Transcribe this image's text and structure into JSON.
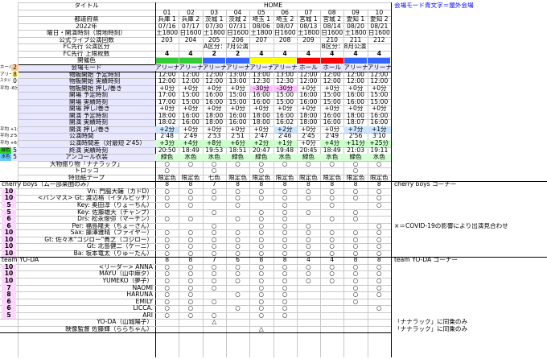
{
  "sheet": {
    "note_right": "会場モード青文字＝屋外会場",
    "colors": {
      "heading_lavender": "#ccccff",
      "lavender_light": "#e7e7ff",
      "navy_cell": "#c9cdea",
      "green_cell": "#33cc33",
      "blue_cell": "#3366ff",
      "yellow_cell": "#ffff00",
      "red_cell": "#ff0000",
      "minus_pink": "#ffc0ff",
      "plus_blue": "#cce5ff",
      "plus_green": "#ccffcc",
      "costume_green": "#d6ffd6",
      "member_pink": "#ffd6ff",
      "blue_text": "#0000ff",
      "purple_text": "#800080"
    },
    "title": "タイトル",
    "home": "HOME",
    "show_numbers": [
      "01",
      "02",
      "03",
      "04",
      "05",
      "06",
      "07",
      "08",
      "09",
      "10"
    ],
    "row_labels": {
      "pref": "都道府県",
      "year": "2022年",
      "date_venue": "曜日・開演時刻（現地時刻）",
      "official_count": "公式ライブ公演回数",
      "fc_kind": "FC先行 公演区分",
      "fc_limit": "FC先行 上限枚数",
      "region_color": "開催色",
      "venue_mode": "会場モード",
      "merch_plan": "物販開始  予定時刻",
      "merch_actual": "物販開始  実績時刻",
      "merch_diff": "物販開始  押し/巻き",
      "open_plan": "開場    予定時刻",
      "open_actual": "開場    実績時刻",
      "open_diff": "開場    押し/巻き",
      "start_plan": "開演    予定時刻",
      "start_actual": "開演    実績時刻",
      "start_diff": "開演    押し/巻き",
      "duration": "公演時間",
      "duration_diff": "公演時間差（対最短 2'45）",
      "end": "終演    実績時刻",
      "encore": "アンコール衣装",
      "flag": "大物振り物「ナナラック」",
      "trolley": "トロッコ",
      "tape": "特効紙テープ"
    },
    "left_margin": {
      "hall": "ホール",
      "hall_n": "2",
      "arena": "アリーナ",
      "arena_n": "8",
      "stadium": "スタジアム",
      "stadium_n": "0",
      "avg1": "平均 -6分",
      "avg2": "平均 +1分",
      "avg3": "平均 2'51",
      "avg4": "平均 +6分",
      "green": "緑色",
      "green_n": "5",
      "blue": "水色",
      "blue_n": "5"
    },
    "prefs": [
      "兵庫 1",
      "兵庫 2",
      "茨城 1",
      "茨城 2",
      "埼玉 1",
      "埼玉 2",
      "宮城 1",
      "宮城 2",
      "愛知 1",
      "愛知 2"
    ],
    "dates": [
      "07/16",
      "07/17",
      "07/30",
      "07/31",
      "08/06",
      "08/07",
      "08/13",
      "08/14",
      "08/20",
      "08/21"
    ],
    "times": [
      "土1800",
      "日1600",
      "土1800",
      "日1600",
      "土1800",
      "日1600",
      "土1800",
      "日1600",
      "土1800",
      "日1600"
    ],
    "counts": [
      "203",
      "204",
      "205",
      "206",
      "207",
      "208",
      "209",
      "210",
      "211",
      "212"
    ],
    "fc_a": "A区分：7月公演",
    "fc_b": "B区分：8月公演",
    "fc_limits": [
      "4",
      "4",
      "2",
      "2",
      "4",
      "4",
      "4",
      "4",
      "4",
      "4"
    ],
    "venue_modes": [
      "アリーナ",
      "アリーナ",
      "アリーナ",
      "アリーナ",
      "アリーナ",
      "アリーナ",
      "ホール",
      "ホール",
      "アリーナ",
      "アリーナ"
    ],
    "merch_plan": [
      "12:00",
      "12:00",
      "12:00",
      "13:00",
      "13:00",
      "13:00",
      "12:00",
      "12:00",
      "12:00",
      "12:00"
    ],
    "merch_actual": [
      "12:00",
      "12:00",
      "12:00",
      "13:00",
      "12:30",
      "12:30",
      "12:00",
      "12:00",
      "12:00",
      "12:00"
    ],
    "merch_diff": [
      "+0分",
      "+0分",
      "+0分",
      "+0分",
      "-30分",
      "-30分",
      "+0分",
      "+0分",
      "+0分",
      "+0分"
    ],
    "open_plan": [
      "17:00",
      "15:00",
      "16:00",
      "15:00",
      "16:00",
      "15:00",
      "16:00",
      "15:00",
      "16:00",
      "15:00"
    ],
    "open_actual": [
      "17:00",
      "15:00",
      "16:00",
      "15:00",
      "16:00",
      "15:00",
      "16:00",
      "15:00",
      "16:00",
      "15:00"
    ],
    "open_diff": [
      "+0分",
      "+0分",
      "+0分",
      "+0分",
      "+0分",
      "+0分",
      "+0分",
      "+0分",
      "+0分",
      "+0分"
    ],
    "start_plan": [
      "18:00",
      "16:00",
      "18:00",
      "16:00",
      "18:00",
      "16:00",
      "18:00",
      "16:00",
      "18:00",
      "16:00"
    ],
    "start_actual": [
      "18:02",
      "16:00",
      "18:00",
      "16:00",
      "18:00",
      "16:02",
      "18:00",
      "16:00",
      "18:07",
      "16:00"
    ],
    "start_diff": [
      "+2分",
      "+0分",
      "+0分",
      "+0分",
      "+0分",
      "+2分",
      "+0分",
      "+0分",
      "+7分",
      "+1分"
    ],
    "durations": [
      "2'48",
      "2'49",
      "2'53",
      "2'51",
      "2'47",
      "2'46",
      "2'45",
      "2'49",
      "2'56",
      "3'10"
    ],
    "duration_diff": [
      "+3分",
      "+4分",
      "+8分",
      "+6分",
      "+2分",
      "+1分",
      "+0分",
      "+4分",
      "+11分",
      "+25分"
    ],
    "end_times": [
      "20:50",
      "18:49",
      "19:53",
      "18:51",
      "20:47",
      "19:48",
      "20:45",
      "18:49",
      "21:03",
      "19:11"
    ],
    "encore": [
      "緑色",
      "水色",
      "水色",
      "緑色",
      "緑色",
      "水色",
      "緑色",
      "水色",
      "緑色",
      "水色"
    ],
    "flag_marks": [
      "○",
      "○",
      "○",
      "○",
      "○",
      "○",
      "○",
      "○",
      "○",
      "○"
    ],
    "trolley_marks": [
      "○",
      "",
      "○",
      "",
      "○",
      "",
      "",
      "",
      "○",
      ""
    ],
    "tape": [
      "限定色",
      "限定色",
      "七色",
      "限定色",
      "限定色",
      "限定色",
      "限定色",
      "限定色",
      "限定色",
      "限定色"
    ],
    "cherry": {
      "header": "cherry boys（ムー部楽曲のみ）",
      "side_note": "cherry boys コーナー",
      "totals": [
        "8",
        "8",
        "7",
        "8",
        "8",
        "8",
        "8",
        "8",
        "8",
        "8"
      ],
      "members": [
        {
          "n": "10",
          "name": "Vn: 門脇大輔（カドD）",
          "marks": [
            "○",
            "○",
            "○",
            "○",
            "○",
            "○",
            "○",
            "○",
            "○",
            "○"
          ]
        },
        {
          "n": "10",
          "name": "<バンマス> Gt: 渡辺格（イタルピッチ）",
          "marks": [
            "○",
            "○",
            "○",
            "○",
            "○",
            "○",
            "○",
            "○",
            "○",
            "○"
          ]
        },
        {
          "n": "5",
          "name": "Key: 奥田淳（りょーちん）",
          "marks": [
            "○",
            "○",
            "",
            "○",
            "",
            "○",
            "",
            "○",
            "",
            "○"
          ]
        },
        {
          "n": "5",
          "name": "Key: 佐藤雄大（チャンプ）",
          "marks": [
            "",
            "",
            "○",
            "",
            "○",
            "○",
            "○",
            "",
            "○",
            ""
          ]
        },
        {
          "n": "6",
          "name": "Drs: 松永俊弥（マーチン）",
          "marks": [
            "○",
            "○",
            "",
            "○",
            "○",
            "○",
            "",
            "○",
            "○",
            ""
          ]
        },
        {
          "n": "6",
          "name": "Per: 福島隆夫（ちょーさん）",
          "marks": [
            "",
            "",
            "○",
            "",
            "○",
            "○",
            "○",
            "",
            "",
            "○"
          ]
        },
        {
          "n": "10",
          "name": "Sax: 藤澤雅晴（ファイヤー）",
          "marks": [
            "○",
            "○",
            "○",
            "○",
            "○",
            "○",
            "○",
            "○",
            "○",
            "○"
          ]
        },
        {
          "n": "10",
          "name": "Gt: 佐々木\"コジロー\"貴之（コジロー）",
          "marks": [
            "○",
            "○",
            "○",
            "○",
            "○",
            "○",
            "○",
            "○",
            "○",
            "○"
          ]
        },
        {
          "n": "10",
          "name": "Gt: 北島健二（ケーニ）",
          "marks": [
            "○",
            "○",
            "○",
            "○",
            "○",
            "○",
            "○",
            "○",
            "○",
            "○"
          ]
        },
        {
          "n": "10",
          "name": "Ba: 坂本竜太（りゅーたん）",
          "marks": [
            "○",
            "○",
            "○",
            "○",
            "○",
            "○",
            "○",
            "○",
            "○",
            "○"
          ]
        }
      ],
      "covid_note": "×＝COVID-19の影響により出演見合わせ"
    },
    "yoda": {
      "header": "team YO-DA",
      "side_note": "team YO-DA コーナー",
      "totals": [
        "8",
        "8",
        "7",
        "6",
        "8",
        "8",
        "4",
        "4",
        "8",
        "8"
      ],
      "members": [
        {
          "n": "10",
          "name": "<リーダー> ANNA",
          "marks": [
            "○",
            "○",
            "○",
            "○",
            "○",
            "○",
            "○",
            "○",
            "○",
            "○"
          ]
        },
        {
          "n": "10",
          "name": "MAYU（山中麻夕）",
          "marks": [
            "○",
            "○",
            "○",
            "○",
            "○",
            "○",
            "○",
            "○",
            "○",
            "○"
          ]
        },
        {
          "n": "10",
          "name": "YUMEKO（夢子）",
          "marks": [
            "○",
            "○",
            "○",
            "○",
            "○",
            "○",
            "○",
            "○",
            "○",
            "○"
          ]
        },
        {
          "n": "7",
          "name": "NAOMI",
          "marks": [
            "○",
            "○",
            "○",
            "",
            "○",
            "○",
            "",
            "",
            "○",
            "○"
          ]
        },
        {
          "n": "8",
          "name": "HARUNA",
          "marks": [
            "○",
            "○",
            "",
            "○",
            "○",
            "○",
            "",
            "",
            "○",
            "○"
          ]
        },
        {
          "n": "6",
          "name": "EMILY",
          "marks": [
            "○",
            "○",
            "○",
            "",
            "○",
            "○",
            "",
            "",
            "○",
            ""
          ]
        },
        {
          "n": "6",
          "name": "LICCA.",
          "marks": [
            "○",
            "○",
            "",
            "○",
            "○",
            "○",
            "",
            "",
            "",
            "○"
          ]
        },
        {
          "n": "5",
          "name": "ARI",
          "marks": [
            "○",
            "○",
            "○",
            "",
            "○",
            "○",
            "",
            "",
            "",
            ""
          ]
        },
        {
          "n": "",
          "name": "YO-DA（山城陽子）",
          "marks": [
            "",
            "",
            "△",
            "",
            "",
            "",
            "",
            "",
            "",
            ""
          ]
        }
      ]
    },
    "nanarakku_note": "「ナナラック」に同乗のみ",
    "director_label": "映像監督 佐藤輝（ららちゃん）",
    "director_marks": [
      "",
      "",
      "",
      "",
      "△",
      "",
      "",
      "",
      "",
      ""
    ]
  }
}
